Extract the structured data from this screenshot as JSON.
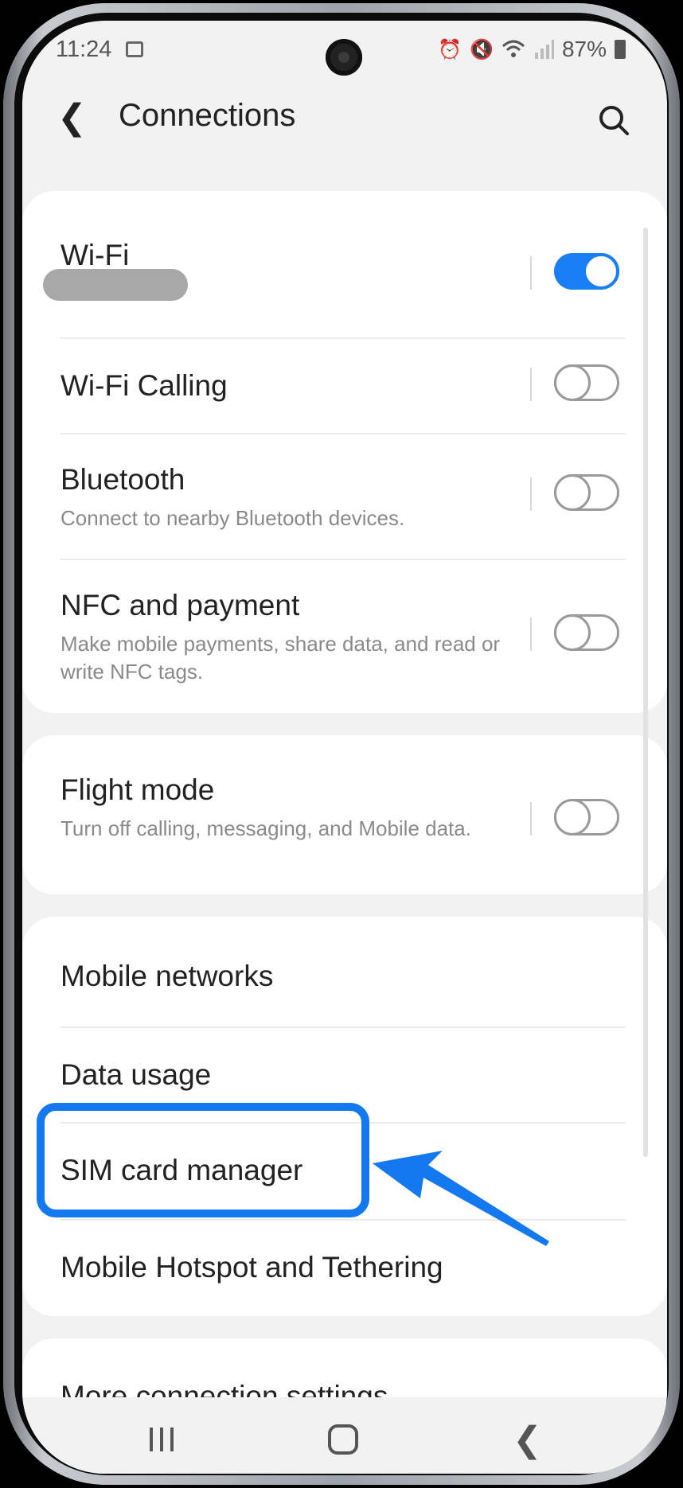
{
  "status_bar": {
    "time": "11:24",
    "battery": "87%",
    "icons": [
      "screenshot-icon",
      "alarm-icon",
      "mute-icon",
      "wifi-icon",
      "signal-icon",
      "battery-icon"
    ]
  },
  "header": {
    "title": "Connections",
    "back_icon": "chevron-left-icon",
    "search_icon": "search-icon"
  },
  "group1": [
    {
      "title": "Wi-Fi",
      "subtitle": "",
      "toggle": true
    },
    {
      "title": "Wi-Fi Calling",
      "subtitle": "",
      "toggle": false
    },
    {
      "title": "Bluetooth",
      "subtitle": "Connect to nearby Bluetooth devices.",
      "toggle": false
    },
    {
      "title": "NFC and payment",
      "subtitle": "Make mobile payments, share data, and read or write NFC tags.",
      "toggle": false
    }
  ],
  "group2": [
    {
      "title": "Flight mode",
      "subtitle": "Turn off calling, messaging, and Mobile data.",
      "toggle": false
    }
  ],
  "group3": [
    {
      "title": "Mobile networks"
    },
    {
      "title": "Data usage"
    },
    {
      "title": "SIM card manager"
    },
    {
      "title": "Mobile Hotspot and Tethering"
    }
  ],
  "group4": [
    {
      "title": "More connection settings"
    }
  ],
  "annotation": {
    "highlight_color": "#1479ef"
  },
  "accent_color": "#1a7ef5",
  "nav_bar": [
    "recents-icon",
    "home-icon",
    "back-icon"
  ]
}
